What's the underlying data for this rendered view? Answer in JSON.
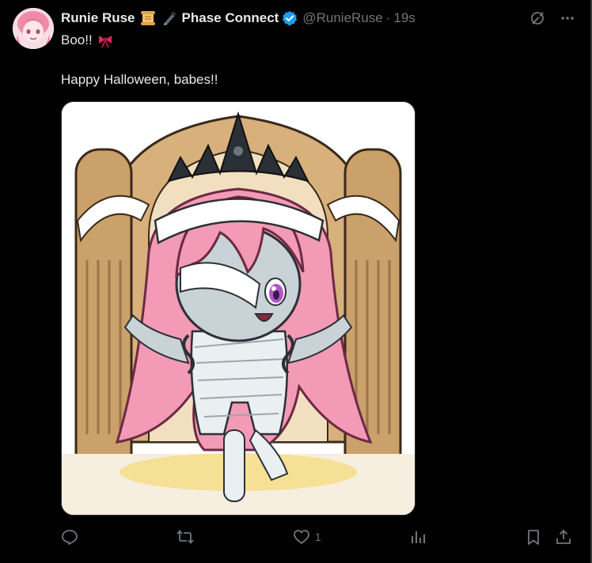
{
  "tweet": {
    "display_name": "Runie Ruse",
    "brand_name": "Phase Connect",
    "handle": "@RunieRuse",
    "separator": "·",
    "time": "19s",
    "line1": "Boo!!",
    "line2": "Happy Halloween, babes!!",
    "media_icon": "image",
    "verified": true,
    "emoji_icons": [
      "scroll-icon",
      "pen-icon",
      "ribbon-icon"
    ]
  },
  "actions": {
    "reply_count": "",
    "repost_count": "",
    "like_count": "1",
    "views_count": ""
  },
  "colors": {
    "background": "#000000",
    "text": "#e7e9ea",
    "muted": "#71767b",
    "verified_blue": "#1d9bf0",
    "ribbon_red": "#e0245e"
  },
  "icons": {
    "top_right": [
      "grok-icon",
      "more-icon"
    ],
    "bottom": [
      "reply-icon",
      "repost-icon",
      "like-icon",
      "views-icon",
      "bookmark-icon",
      "share-icon"
    ]
  }
}
